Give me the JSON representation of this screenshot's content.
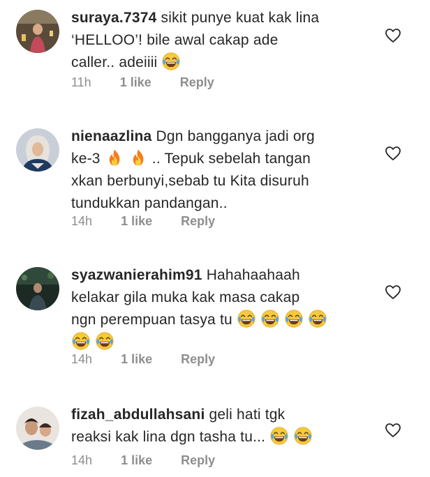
{
  "comments": [
    {
      "username": "suraya.7374",
      "lines": [
        "sikit punye kuat kak lina",
        "‘HELLOO’! bile awal cakap ade",
        "caller.. adeiiii"
      ],
      "time": "11h",
      "likes": "1 like",
      "reply": "Reply"
    },
    {
      "username": "nienaazlina",
      "lines": [
        "Dgn bangganya jadi org",
        "ke-3",
        ".. Tepuk sebelah tangan",
        "xkan berbunyi,sebab tu Kita disuruh",
        "tundukkan pandangan.."
      ],
      "time": "14h",
      "likes": "1 like",
      "reply": "Reply"
    },
    {
      "username": "syazwanierahim91",
      "lines": [
        "Hahahaahaah",
        "kelakar gila muka kak masa cakap",
        "ngn perempuan tasya tu"
      ],
      "time": "14h",
      "likes": "1 like",
      "reply": "Reply"
    },
    {
      "username": "fizah_abdullahsani",
      "lines": [
        "geli hati tgk",
        "reaksi kak lina dgn tasha tu..."
      ],
      "time": "14h",
      "likes": "1 like",
      "reply": "Reply"
    }
  ],
  "icons": {
    "like": "heart-outline-icon",
    "laugh": "face-with-tears-of-joy-emoji",
    "fire": "fire-emoji"
  },
  "colors": {
    "text": "#262626",
    "secondary": "#8e8e8e"
  }
}
